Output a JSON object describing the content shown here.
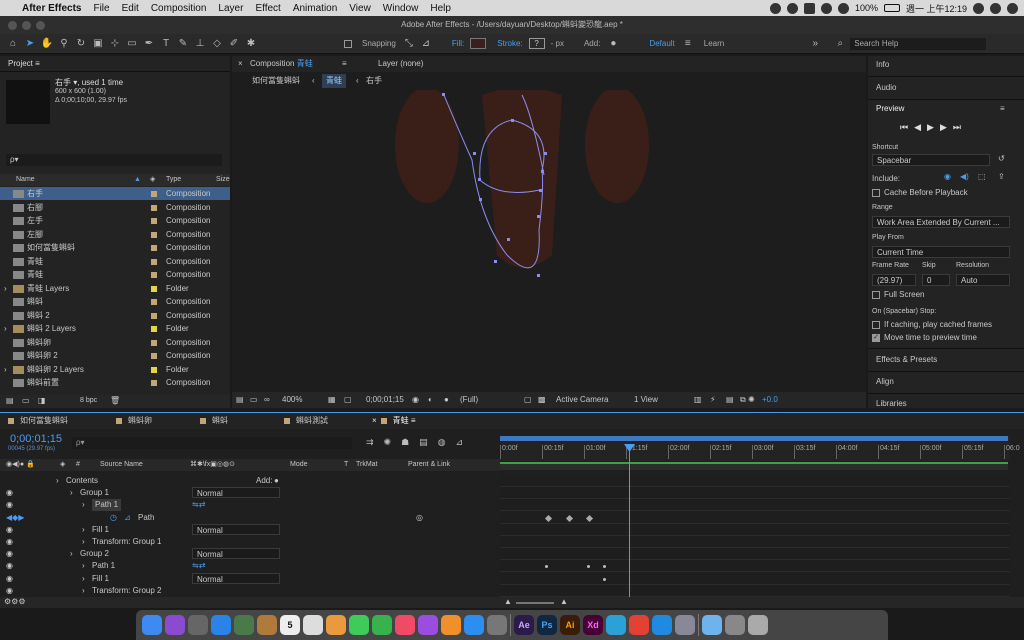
{
  "menubar": {
    "apple": "",
    "app": "After Effects",
    "items": [
      "File",
      "Edit",
      "Composition",
      "Layer",
      "Effect",
      "Animation",
      "View",
      "Window",
      "Help"
    ],
    "battery": "100%",
    "datetime": "週一 上午12:19"
  },
  "title": "Adobe After Effects - /Users/dayuan/Desktop/蝌蚪變恐龍.aep *",
  "toolbar": {
    "snapping": "Snapping",
    "fill": "Fill:",
    "stroke": "Stroke:",
    "stroke_value": "?",
    "px": "- px",
    "add": "Add:",
    "workspace": "Default",
    "learn": "Learn",
    "search_placeholder": "Search Help"
  },
  "project": {
    "title": "Project",
    "item_name": "右手 ▾",
    "used": ", used 1 time",
    "dims": "600 x 600 (1.00)",
    "duration": "Δ 0;00;10;00, 29.97 fps",
    "search_placeholder": "ρ▾",
    "col_name": "Name",
    "col_type": "Type",
    "col_size": "Size",
    "bpc": "8 bpc",
    "items": [
      {
        "name": "右手",
        "type": "Composition",
        "kind": "comp",
        "sel": true
      },
      {
        "name": "右腳",
        "type": "Composition",
        "kind": "comp"
      },
      {
        "name": "左手",
        "type": "Composition",
        "kind": "comp"
      },
      {
        "name": "左腳",
        "type": "Composition",
        "kind": "comp"
      },
      {
        "name": "如何當隻蝌蚪",
        "type": "Composition",
        "kind": "comp"
      },
      {
        "name": "青蛙",
        "type": "Composition",
        "kind": "comp"
      },
      {
        "name": "青蛙",
        "type": "Composition",
        "kind": "comp"
      },
      {
        "name": "青蛙 Layers",
        "type": "Folder",
        "kind": "folder"
      },
      {
        "name": "蝌蚪",
        "type": "Composition",
        "kind": "comp"
      },
      {
        "name": "蝌蚪 2",
        "type": "Composition",
        "kind": "comp"
      },
      {
        "name": "蝌蚪 2 Layers",
        "type": "Folder",
        "kind": "folder"
      },
      {
        "name": "蝌蚪卵",
        "type": "Composition",
        "kind": "comp"
      },
      {
        "name": "蝌蚪卵 2",
        "type": "Composition",
        "kind": "comp"
      },
      {
        "name": "蝌蚪卵 2 Layers",
        "type": "Folder",
        "kind": "folder"
      },
      {
        "name": "蝌蚪前置",
        "type": "Composition",
        "kind": "comp"
      }
    ]
  },
  "comp": {
    "tab": "Composition",
    "tab_name": "青蛙",
    "layer_tab": "Layer (none)",
    "crumbs": [
      "如何當隻蝌蚪",
      "青蛙",
      "右手"
    ],
    "zoom": "400%",
    "timecode": "0;00;01;15",
    "resolution": "(Full)",
    "camera": "Active Camera",
    "views": "1 View",
    "exposure": "+0.0"
  },
  "right": {
    "info": "Info",
    "audio": "Audio",
    "preview": "Preview",
    "shortcut_label": "Shortcut",
    "shortcut": "Spacebar",
    "include": "Include:",
    "cache": "Cache Before Playback",
    "range_label": "Range",
    "range": "Work Area Extended By Current ...",
    "playfrom_label": "Play From",
    "playfrom": "Current Time",
    "fr_label": "Frame Rate",
    "skip_label": "Skip",
    "res_label": "Resolution",
    "fr": "(29.97)",
    "skip": "0",
    "res": "Auto",
    "fullscreen": "Full Screen",
    "stop_label": "On (Spacebar) Stop:",
    "stop1": "If caching, play cached frames",
    "stop2": "Move time to preview time",
    "effects": "Effects & Presets",
    "align": "Align",
    "libraries": "Libraries"
  },
  "timeline": {
    "tabs": [
      "如何當隻蝌蚪",
      "蝌蚪卵",
      "蝌蚪",
      "蝌蚪測試",
      "青蛙"
    ],
    "timecode": "0;00;01;15",
    "frames": "00045 (29.97 fps)",
    "col_source": "Source Name",
    "col_mode": "Mode",
    "col_t": "T",
    "col_trkmat": "TrkMat",
    "col_parent": "Parent & Link",
    "ruler": [
      "0:00f",
      "00:15f",
      "01:00f",
      "01:15f",
      "02:00f",
      "02:15f",
      "03:00f",
      "03:15f",
      "04:00f",
      "04:15f",
      "05:00f",
      "05:15f",
      "06:0"
    ],
    "rows": [
      {
        "label": "Contents",
        "indent": 66,
        "mode": "",
        "add": "Add:"
      },
      {
        "label": "Group 1",
        "indent": 80,
        "mode": "Normal"
      },
      {
        "label": "Path 1",
        "indent": 92,
        "mode": "",
        "hl": true
      },
      {
        "label": "Path",
        "indent": 112,
        "mode": ""
      },
      {
        "label": "Fill 1",
        "indent": 92,
        "mode": "Normal"
      },
      {
        "label": "Transform: Group 1",
        "indent": 92,
        "mode": ""
      },
      {
        "label": "Group 2",
        "indent": 80,
        "mode": "Normal"
      },
      {
        "label": "Path 1",
        "indent": 92,
        "mode": ""
      },
      {
        "label": "Fill 1",
        "indent": 92,
        "mode": "Normal"
      },
      {
        "label": "Transform: Group 2",
        "indent": 92,
        "mode": ""
      }
    ]
  },
  "dock": [
    {
      "name": "finder",
      "txt": "",
      "c": "#3d8bf2"
    },
    {
      "name": "siri",
      "txt": "",
      "c": "#8a4bd1"
    },
    {
      "name": "launchpad",
      "txt": "",
      "c": "#666"
    },
    {
      "name": "safari",
      "txt": "",
      "c": "#2a83e8"
    },
    {
      "name": "preview",
      "txt": "",
      "c": "#4a7a4a"
    },
    {
      "name": "notes",
      "txt": "",
      "c": "#b07a3c"
    },
    {
      "name": "calendar",
      "txt": "5",
      "c": "#eee"
    },
    {
      "name": "reminders",
      "txt": "",
      "c": "#ddd"
    },
    {
      "name": "photos",
      "txt": "",
      "c": "#e89a3c"
    },
    {
      "name": "messages",
      "txt": "",
      "c": "#3ecb58"
    },
    {
      "name": "facetime",
      "txt": "",
      "c": "#37b24d"
    },
    {
      "name": "music",
      "txt": "",
      "c": "#f04b66"
    },
    {
      "name": "podcasts",
      "txt": "",
      "c": "#9b4de0"
    },
    {
      "name": "books",
      "txt": "",
      "c": "#f0902a"
    },
    {
      "name": "appstore",
      "txt": "",
      "c": "#2b8ef0"
    },
    {
      "name": "system-prefs",
      "txt": "",
      "c": "#777"
    },
    {
      "name": "after-effects",
      "txt": "Ae",
      "c": "#2b1a4a"
    },
    {
      "name": "photoshop",
      "txt": "Ps",
      "c": "#0f2740"
    },
    {
      "name": "illustrator",
      "txt": "Ai",
      "c": "#3a1d08"
    },
    {
      "name": "xd",
      "txt": "Xd",
      "c": "#470137"
    },
    {
      "name": "telegram",
      "txt": "",
      "c": "#2aa1d8"
    },
    {
      "name": "chrome",
      "txt": "",
      "c": "#e34133"
    },
    {
      "name": "edge",
      "txt": "",
      "c": "#1f8ae0"
    },
    {
      "name": "filemerge",
      "txt": "",
      "c": "#889"
    },
    {
      "name": "folder",
      "txt": "",
      "c": "#6fb3ee"
    },
    {
      "name": "screenshot",
      "txt": "",
      "c": "#888"
    },
    {
      "name": "trash",
      "txt": "",
      "c": "#aaa"
    }
  ]
}
